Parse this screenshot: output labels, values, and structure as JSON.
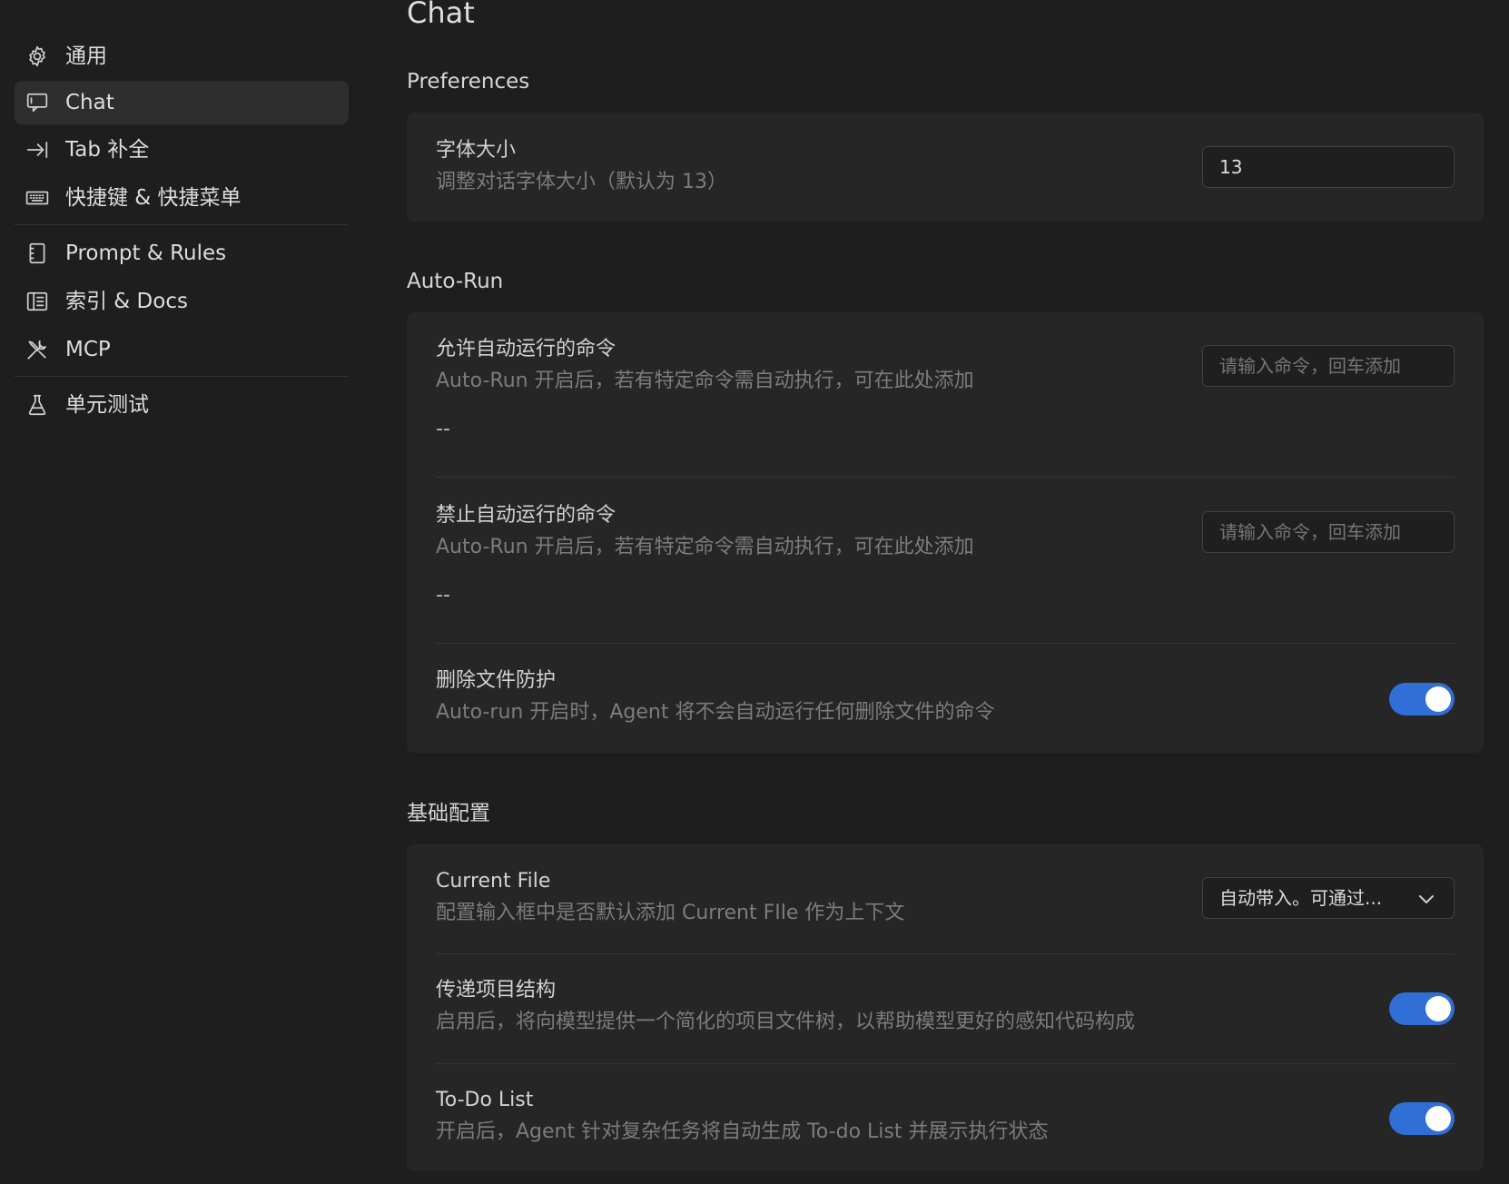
{
  "sidebar": {
    "items": [
      {
        "label": "通用",
        "icon": "gear-icon"
      },
      {
        "label": "Chat",
        "icon": "chat-icon",
        "active": true
      },
      {
        "label": "Tab 补全",
        "icon": "tab-arrow-icon"
      },
      {
        "label": "快捷键 & 快捷菜单",
        "icon": "keyboard-icon"
      },
      {
        "label": "Prompt & Rules",
        "icon": "notebook-icon"
      },
      {
        "label": "索引 & Docs",
        "icon": "docs-icon"
      },
      {
        "label": "MCP",
        "icon": "tools-icon"
      },
      {
        "label": "单元测试",
        "icon": "flask-icon"
      }
    ]
  },
  "main": {
    "title": "Chat",
    "preferences": {
      "section_title": "Preferences",
      "font_size": {
        "title": "字体大小",
        "desc": "调整对话字体大小（默认为 13）",
        "value": "13"
      }
    },
    "autorun": {
      "section_title": "Auto-Run",
      "allow": {
        "title": "允许自动运行的命令",
        "desc": "Auto-Run 开启后，若有特定命令需自动执行，可在此处添加",
        "empty": "--",
        "placeholder": "请输入命令，回车添加"
      },
      "deny": {
        "title": "禁止自动运行的命令",
        "desc": "Auto-Run 开启后，若有特定命令需自动执行，可在此处添加",
        "empty": "--",
        "placeholder": "请输入命令，回车添加"
      },
      "delete_protect": {
        "title": "删除文件防护",
        "desc": "Auto-run 开启时，Agent 将不会自动运行任何删除文件的命令",
        "enabled": true
      }
    },
    "basic": {
      "section_title": "基础配置",
      "current_file": {
        "title": "Current File",
        "desc": "配置输入框中是否默认添加 Current FIle 作为上下文",
        "selected": "自动带入。可通过..."
      },
      "project_structure": {
        "title": "传递项目结构",
        "desc": "启用后，将向模型提供一个简化的项目文件树，以帮助模型更好的感知代码构成",
        "enabled": true
      },
      "todo_list": {
        "title": "To-Do List",
        "desc": "开启后，Agent 针对复杂任务将自动生成 To-do List 并展示执行状态",
        "enabled": true
      }
    }
  },
  "colors": {
    "background": "#1e1e1e",
    "card": "#262626",
    "active_item": "#2e2e2e",
    "toggle_on": "#2f6fd6"
  }
}
